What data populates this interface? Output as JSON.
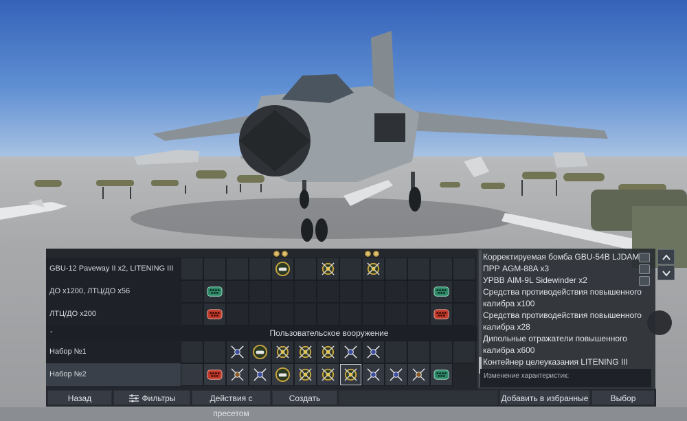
{
  "loadout_rows": [
    {
      "label": "GBU-12 Paveway II x2,  LITENING III"
    },
    {
      "label": "ДО x1200,  ЛТЦ/ДО x56"
    },
    {
      "label": "ЛТЦ/ДО x200"
    }
  ],
  "section": {
    "dash": "-",
    "title": "Пользовательское вооружение"
  },
  "preset_rows": [
    {
      "label": "Набор №1"
    },
    {
      "label": "Набор №2"
    }
  ],
  "weapons_list": [
    "Корректируемая бомба GBU-54B LJDAM x3",
    "ПРР AGM-88A x3",
    "УРВВ AIM-9L Sidewinder x2",
    "Средства противодействия повышенного",
    "калибра x100",
    "Средства противодействия повышенного",
    "калибра x28",
    "Дипольные отражатели повышенного",
    "калибра x600",
    "Контейнер целеуказания LITENING III"
  ],
  "changes_label": "Изменение характеристик:",
  "buttons": {
    "back": "Назад",
    "filters": "Фильтры",
    "preset_actions": "Действия с пресетом",
    "create": "Создать",
    "add_favorites": "Добавить в избранные",
    "select": "Выбор"
  },
  "icons": {
    "filters": "sliders-icon",
    "scroll_up": "chevron-up-icon",
    "scroll_down": "chevron-down-icon",
    "weapon_edit": "missile-edit-icon"
  },
  "colors": {
    "panel": "#1e2228",
    "selected_row": "#3a4049",
    "countermeasure_red": "#c0392b",
    "countermeasure_green": "#2f8a6a",
    "bomb_gold": "#c9a640"
  }
}
